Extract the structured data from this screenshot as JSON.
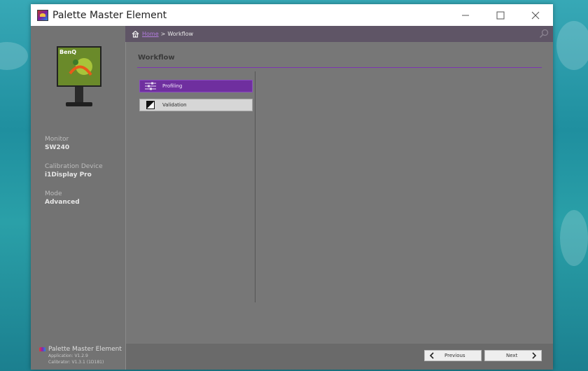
{
  "window": {
    "title": "Palette Master Element"
  },
  "breadcrumb": {
    "home": "Home",
    "separator": ">",
    "current": "Workflow"
  },
  "sidebar": {
    "monitor_label": "Monitor",
    "monitor_value": "SW240",
    "device_label": "Calibration Device",
    "device_value": "i1Display Pro",
    "mode_label": "Mode",
    "mode_value": "Advanced",
    "brand": {
      "brand_logo_text": "BenQ",
      "name": "Palette Master Element",
      "application_version": "Application: V1.2.9",
      "calibrator_version": "Calibrator: V1.3.1 (1D181)"
    }
  },
  "main": {
    "section_title": "Workflow",
    "menu_items": [
      {
        "label": "Profiling",
        "icon": "sliders-icon",
        "active": true
      },
      {
        "label": "Validation",
        "icon": "contrast-icon",
        "active": false
      }
    ]
  },
  "footer_nav": {
    "previous_label": "Previous",
    "next_label": "Next"
  },
  "colors": {
    "accent_purple": "#6f2f9f",
    "header_bar": "#5f5566",
    "link": "#b37cde"
  }
}
